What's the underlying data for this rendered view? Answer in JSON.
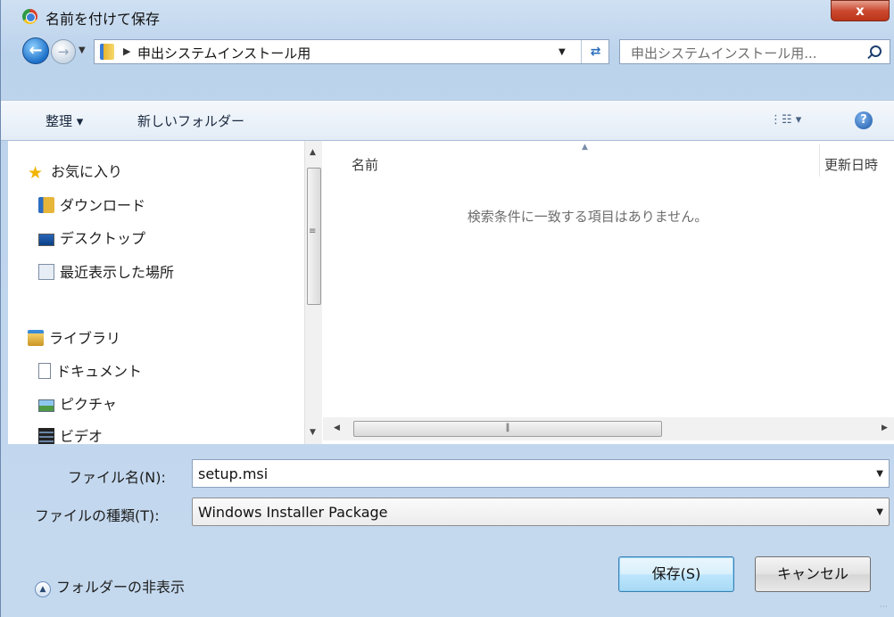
{
  "window": {
    "title": "名前を付けて保存",
    "close_label": "x"
  },
  "address": {
    "crumb": "申出システムインストール用",
    "search_placeholder": "申出システムインストール用..."
  },
  "toolbar": {
    "organize": "整理 ▾",
    "new_folder": "新しいフォルダー",
    "views": "⋮☷ ▾",
    "help": "?"
  },
  "nav": {
    "favorites": "お気に入り",
    "downloads": "ダウンロード",
    "desktop": "デスクトップ",
    "recent": "最近表示した場所",
    "libraries": "ライブラリ",
    "documents": "ドキュメント",
    "pictures": "ピクチャ",
    "videos": "ビデオ"
  },
  "file_list": {
    "col_name": "名前",
    "col_date": "更新日時",
    "empty_message": "検索条件に一致する項目はありません。"
  },
  "fields": {
    "filename_label": "ファイル名(N):",
    "filename_value": "setup.msi",
    "filetype_label": "ファイルの種類(T):",
    "filetype_value": "Windows Installer Package"
  },
  "footer": {
    "hide_folders": "フォルダーの非表示",
    "save_button": "保存(S)",
    "cancel_button": "キャンセル"
  }
}
